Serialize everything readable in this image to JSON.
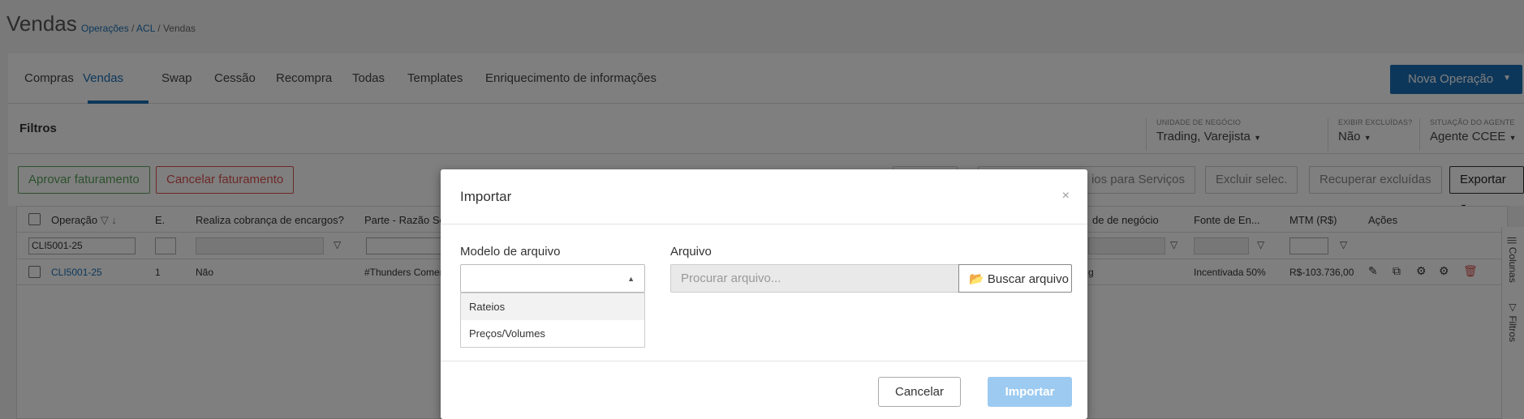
{
  "header": {
    "title": "Vendas",
    "breadcrumb": [
      "Operações",
      "ACL",
      "Vendas"
    ]
  },
  "tabs": [
    "Compras",
    "Vendas",
    "Swap",
    "Cessão",
    "Recompra",
    "Todas",
    "Templates",
    "Enriquecimento de informações"
  ],
  "new_button": "Nova Operação",
  "filters": {
    "title": "Filtros",
    "unidade_caption": "UNIDADE DE NEGÓCIO",
    "unidade_value": "Trading, Varejista",
    "excluidas_caption": "EXIBIR EXCLUÍDAS?",
    "excluidas_value": "Não",
    "situacao_caption": "SITUAÇÃO DO AGENTE",
    "situacao_value": "Agente CCEE"
  },
  "actions": {
    "aprovar": "Aprovar faturamento",
    "cancelar": "Cancelar faturamento",
    "servicos": "ios para Serviços",
    "excluir": "Excluir selec.",
    "recuperar": "Recuperar excluídas",
    "exportar": "Exportar"
  },
  "grid": {
    "columns": {
      "operacao": "Operação",
      "e": "E.",
      "encargos": "Realiza cobrança de encargos?",
      "parte": "Parte - Razão Soc",
      "unidade": "de de negócio",
      "fonte": "Fonte de En...",
      "mtm": "MTM (R$)",
      "acoes": "Ações"
    },
    "filter_operacao": "CLI5001-25",
    "row": {
      "operacao": "CLI5001-25",
      "e": "1",
      "encargos": "Não",
      "parte": "#Thunders Comer",
      "unidade": "g",
      "fonte": "Incentivada 50%",
      "mtm": "R$-103.736,00"
    },
    "side_columns": "Colunas",
    "side_filters": "Filtros"
  },
  "modal": {
    "title": "Importar",
    "close": "×",
    "modelo_label": "Modelo de arquivo",
    "arquivo_label": "Arquivo",
    "file_placeholder": "Procurar arquivo...",
    "buscar": "Buscar arquivo",
    "options": [
      "Rateios",
      "Preços/Volumes"
    ],
    "cancel": "Cancelar",
    "import": "Importar"
  },
  "colors": {
    "primary": "#1a6fb5",
    "import_disabled": "#9dcaf0",
    "approve": "#5ba35b",
    "cancel_red": "#d9534f"
  }
}
